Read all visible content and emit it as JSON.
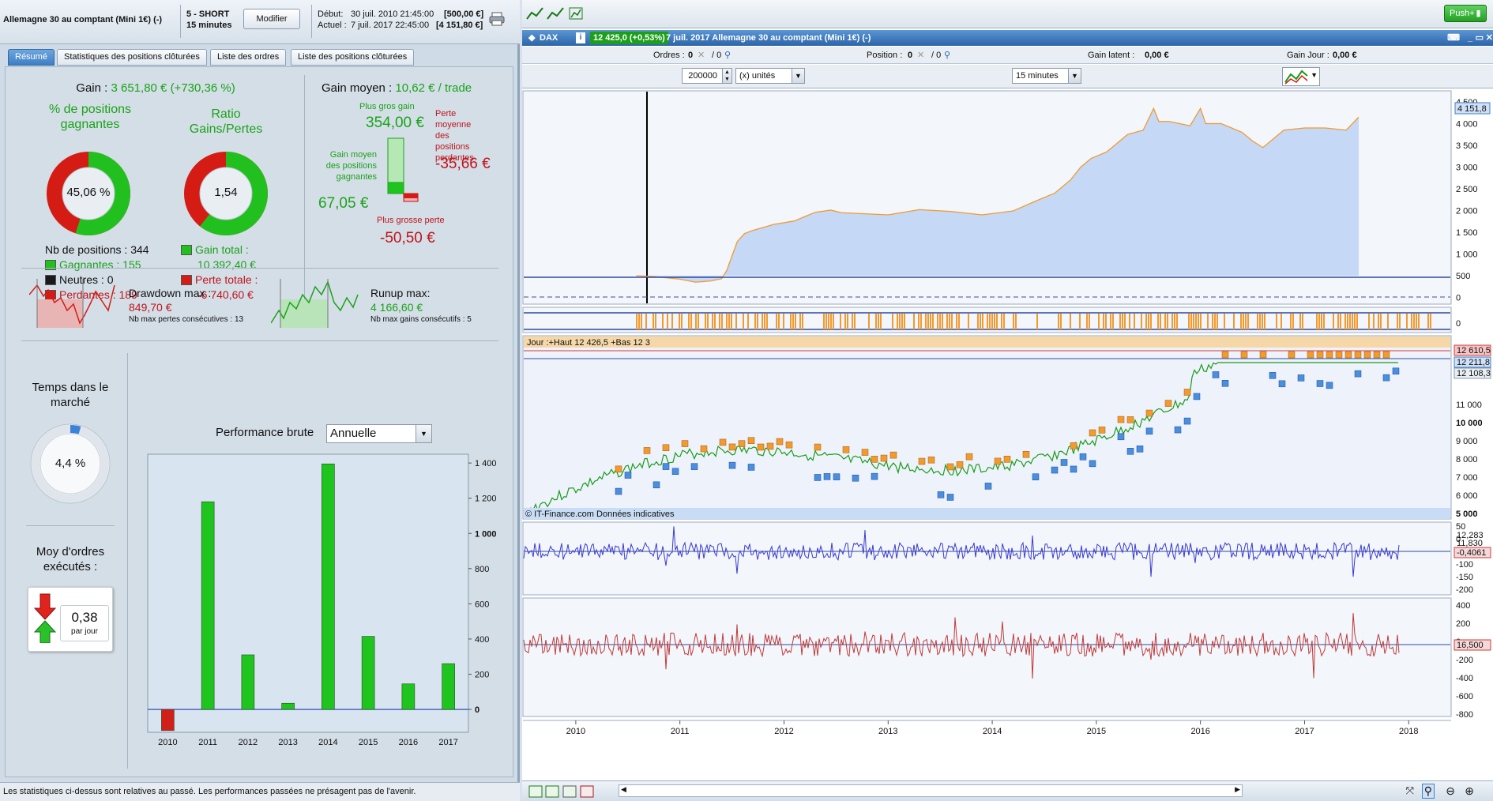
{
  "strategy": {
    "title": "Allemagne 30 au comptant (Mini 1€) (-)",
    "mode": "5 - SHORT",
    "timeframe": "15 minutes",
    "modify_label": "Modifier",
    "debut_label": "Début:",
    "debut_date": "30 juil. 2010 21:45:00",
    "debut_value": "[500,00 €]",
    "actuel_label": "Actuel :",
    "actuel_date": "7 juil. 2017 22:45:00",
    "actuel_value": "[4 151,80 €]"
  },
  "tabs": [
    "Résumé",
    "Statistiques des positions clôturées",
    "Liste des ordres",
    "Liste des positions clôturées"
  ],
  "summary": {
    "gain_label": "Gain :",
    "gain_value": "3 651,80 € (+730,36 %)",
    "pct_win_label": "% de positions gagnantes",
    "pct_win_value": "45,06 %",
    "pct_win_fraction": 0.4506,
    "ratio_label": "Ratio Gains/Pertes",
    "ratio_value": "1,54",
    "ratio_fraction": 0.606,
    "nb_positions_label": "Nb de positions :",
    "nb_positions": "344",
    "gagnantes_label": "Gagnantes :",
    "gagnantes": "155",
    "neutres_label": "Neutres :",
    "neutres": "0",
    "perdantes_label": "Perdantes :",
    "perdantes": "189",
    "gain_total_label": "Gain total :",
    "gain_total": "10 392,40 €",
    "perte_totale_label": "Perte totale :",
    "perte_totale": "-6 740,60 €",
    "gain_moyen_label": "Gain moyen :",
    "gain_moyen_value": "10,62 € / trade",
    "plus_gros_gain_label": "Plus gros gain",
    "plus_gros_gain": "354,00 €",
    "gain_moyen_pos_label": "Gain moyen des positions gagnantes",
    "gain_moyen_pos": "67,05 €",
    "perte_moyenne_label": "Perte moyenne des positions perdantes",
    "perte_moyenne": "-35,66 €",
    "plus_grosse_perte_label": "Plus grosse perte",
    "plus_grosse_perte": "-50,50 €",
    "drawdown_label": "Drawdown max :",
    "drawdown_value": "849,70 €",
    "drawdown_sub": "Nb max pertes consécutives : 13",
    "runup_label": "Runup max:",
    "runup_value": "4 166,60 €",
    "runup_sub": "Nb max gains consécutifs : 5",
    "temps_label": "Temps dans le marché",
    "temps_value": "4,4 %",
    "temps_fraction": 0.044,
    "moy_ordres_label": "Moy d'ordres exécutés :",
    "moy_ordres_value": "0,38",
    "moy_ordres_unit": "par jour",
    "perf_label": "Performance brute",
    "perf_select": "Annuelle",
    "footer": "Les statistiques ci-dessus sont relatives au passé. Les performances passées ne présagent pas de l'avenir."
  },
  "chart_data": [
    {
      "type": "bar",
      "categories": [
        "2010",
        "2011",
        "2012",
        "2013",
        "2014",
        "2015",
        "2016",
        "2017"
      ],
      "values": [
        -120,
        1180,
        310,
        35,
        1395,
        415,
        145,
        260
      ],
      "yticks": [
        "1 400",
        "1 200",
        "1 000",
        "800",
        "600",
        "400",
        "200",
        "0"
      ],
      "ylim": [
        -130,
        1450
      ],
      "colors": {
        "positive": "#1fc41f",
        "negative": "#d0201a"
      }
    },
    {
      "type": "area",
      "x_years": [
        2010.58,
        2010.75,
        2011.0,
        2011.15,
        2011.3,
        2011.4,
        2011.45,
        2011.55,
        2011.62,
        2011.7,
        2011.9,
        2012.1,
        2012.3,
        2012.45,
        2012.55,
        2013.0,
        2013.3,
        2013.6,
        2013.9,
        2014.2,
        2014.4,
        2014.6,
        2014.75,
        2014.85,
        2014.95,
        2015.1,
        2015.3,
        2015.45,
        2015.55,
        2015.6,
        2015.7,
        2015.9,
        2016.0,
        2016.05,
        2016.2,
        2016.4,
        2016.5,
        2016.6,
        2016.8,
        2017.0,
        2017.2,
        2017.4,
        2017.52
      ],
      "values": [
        500,
        480,
        420,
        350,
        380,
        430,
        620,
        1280,
        1470,
        1540,
        1680,
        1760,
        1960,
        2010,
        1950,
        1900,
        2020,
        1980,
        1900,
        1990,
        2200,
        2400,
        2700,
        3000,
        3200,
        3350,
        3750,
        3850,
        4350,
        4050,
        4050,
        3950,
        4350,
        4000,
        4000,
        3800,
        3600,
        3450,
        3850,
        3900,
        3900,
        3850,
        4150
      ],
      "yticks": [
        "4 500",
        "4 000",
        "3 500",
        "3 000",
        "2 500",
        "2 000",
        "1 500",
        "1 000",
        "500",
        "0"
      ],
      "ylim": [
        -100,
        4700
      ],
      "last_label": "4 151,8",
      "colors": {
        "fill": "#c5d8f6",
        "line": "#f29a2e"
      }
    }
  ],
  "chart_panel": {
    "instrument": "DAX",
    "quote": "12 425,0 (+0,53%)",
    "title": "7 juil. 2017 Allemagne 30 au comptant (Mini 1€) (-)",
    "ordres_label": "Ordres :",
    "ordres_value": "0",
    "ordres_slash": "/ 0",
    "position_label": "Position :",
    "position_value": "0",
    "position_slash": "/ 0",
    "gain_latent_label": "Gain latent :",
    "gain_latent": "0,00 €",
    "gain_jour_label": "Gain Jour :",
    "gain_jour": "0,00 €",
    "quantity": "200000",
    "units": "(x) unités",
    "interval": "15 minutes",
    "push_label": "Push+",
    "price_label": "Jour :+Haut 12 426,5 +Bas 12 3",
    "source_label": "© IT-Finance.com Données indicatives",
    "price_yticks": [
      "11 000",
      "10 000",
      "9 000",
      "8 000",
      "7 000",
      "6 000",
      "5 000"
    ],
    "price_tags": [
      "12 610,5",
      "12 211,8",
      "12 108,3"
    ],
    "ind1_yticks": [
      "50",
      "0",
      "-50",
      "-100",
      "-150",
      "-200"
    ],
    "ind1_tags": [
      "12,283",
      "11,830",
      "-0,4061"
    ],
    "ind2_yticks": [
      "400",
      "200",
      "0",
      "-200",
      "-400",
      "-600",
      "-800"
    ],
    "ind2_tag": "16,500",
    "x_years": [
      "2010",
      "2011",
      "2012",
      "2013",
      "2014",
      "2015",
      "2016",
      "2017",
      "2018"
    ],
    "pos_axis_zero": "0"
  }
}
